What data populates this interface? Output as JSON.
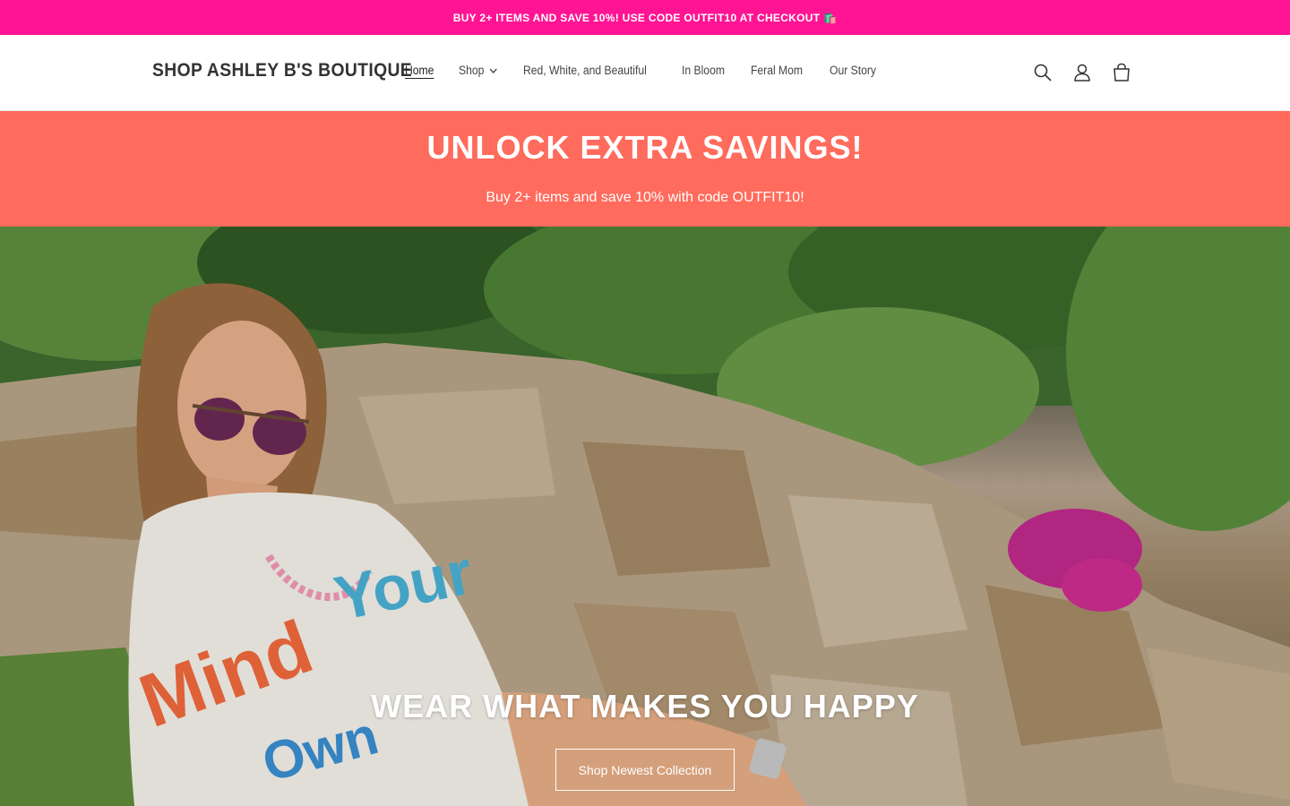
{
  "announcement": {
    "text": "BUY 2+ ITEMS AND SAVE 10%! USE CODE OUTFIT10 AT CHECKOUT 🛍️"
  },
  "header": {
    "logo": "SHOP ASHLEY B'S BOUTIQUE",
    "nav": [
      {
        "label": "Home"
      },
      {
        "label": "Shop"
      },
      {
        "label": "Red, White, and Beautiful"
      },
      {
        "label": "In Bloom"
      },
      {
        "label": "Feral Mom"
      },
      {
        "label": "Our Story"
      }
    ],
    "icons": [
      "search-icon",
      "account-icon",
      "cart-icon"
    ]
  },
  "promo": {
    "title": "UNLOCK EXTRA SAVINGS!",
    "subtitle": "Buy 2+ items and save 10% with code OUTFIT10!"
  },
  "hero": {
    "title": "WEAR WHAT MAKES YOU HAPPY",
    "button_label": "Shop Newest Collection",
    "shirt_text": "Mind Your Own Outfit"
  },
  "colors": {
    "announcement_bg": "#ff1493",
    "promo_bg": "#ff6b5c",
    "text": "#333333"
  }
}
